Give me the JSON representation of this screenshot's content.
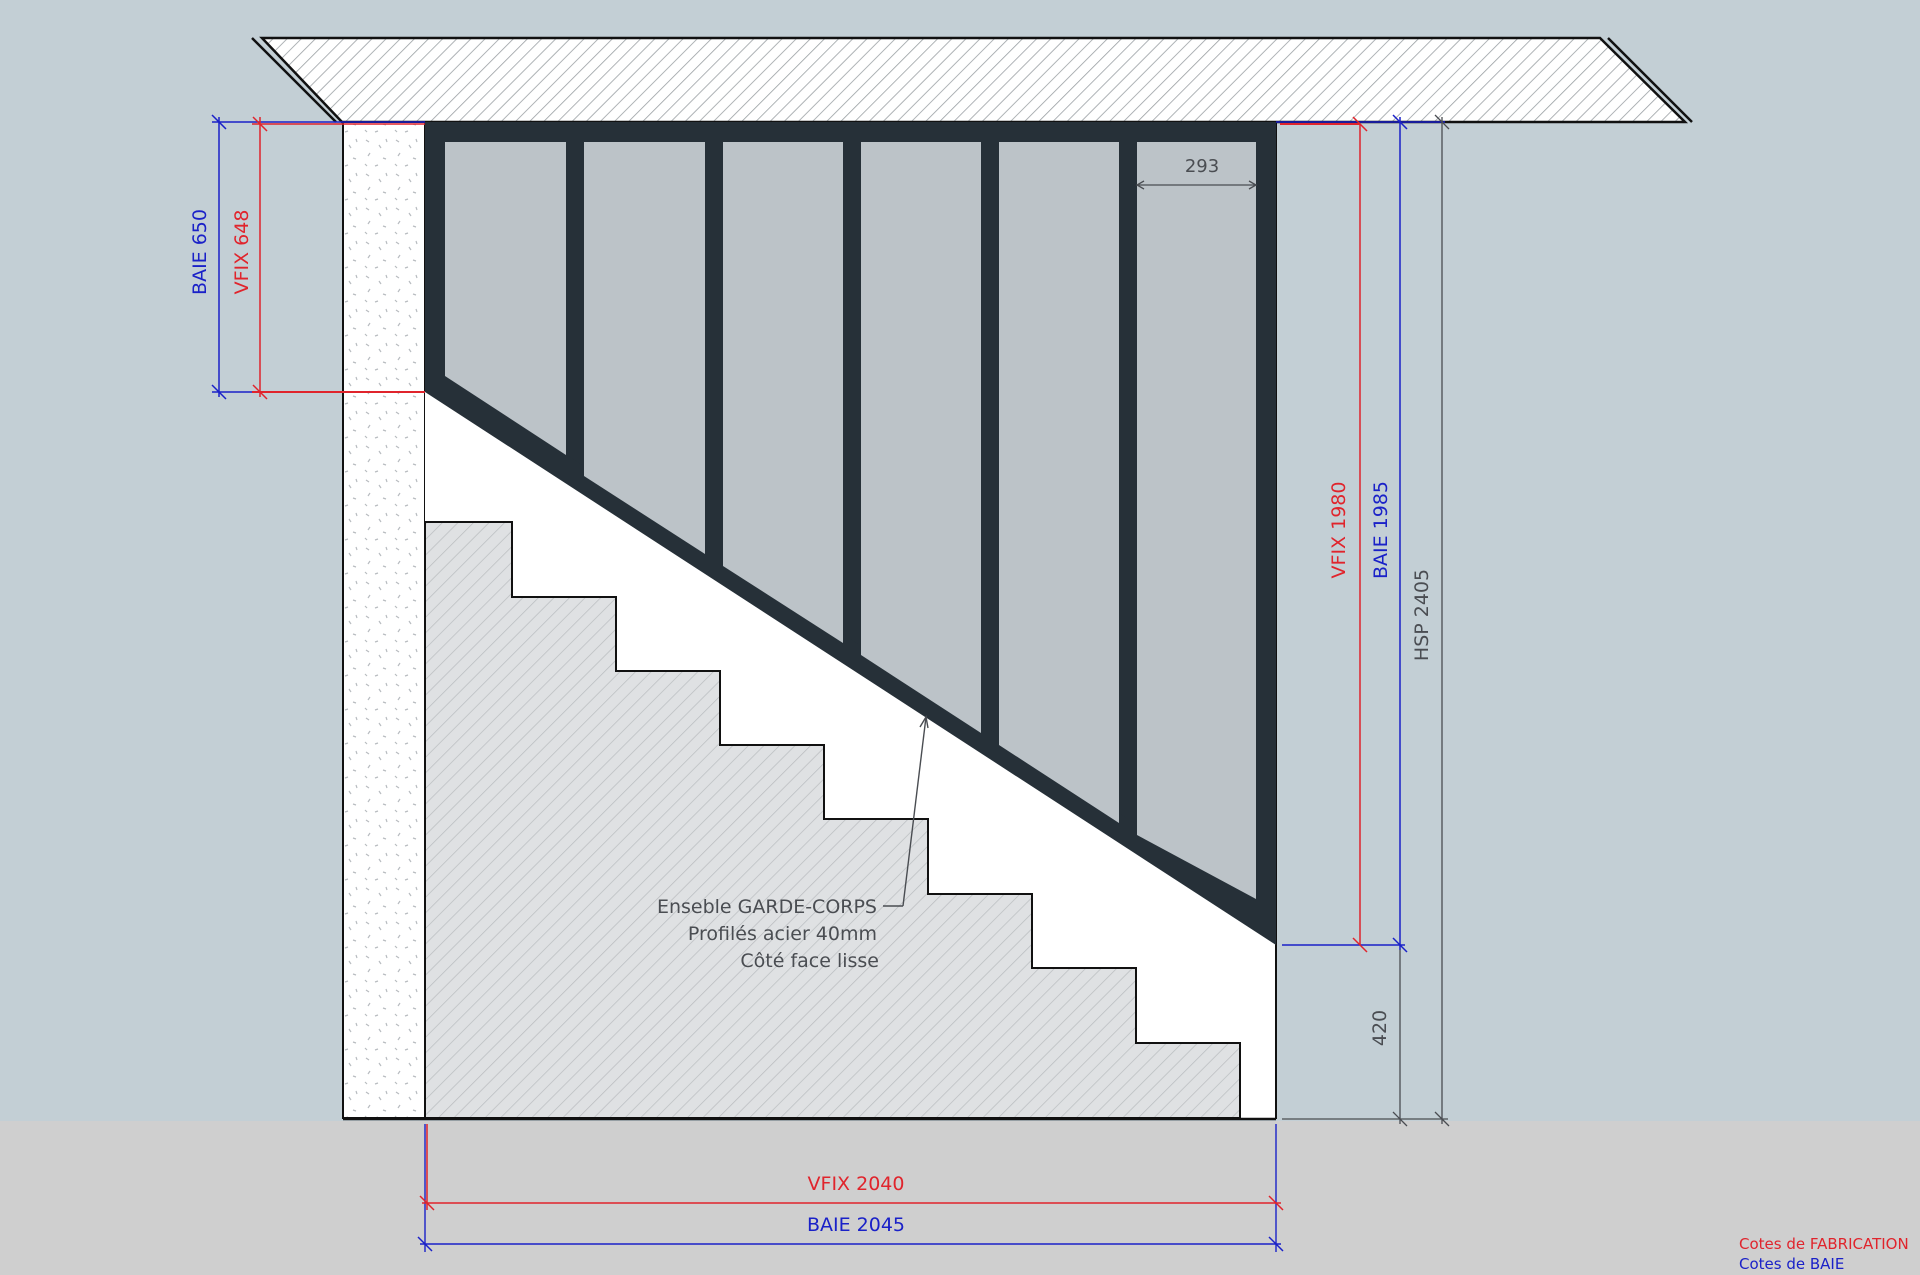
{
  "diagram": {
    "dimensions": {
      "baie_650": "BAIE 650",
      "vfix_648": "VFIX 648",
      "vfix_1980": "VFIX 1980",
      "baie_1985": "BAIE 1985",
      "hsp_2405": "HSP 2405",
      "panel_width": "293",
      "bottom_gap": "420",
      "vfix_2040": "VFIX 2040",
      "baie_2045": "BAIE 2045"
    },
    "annotation": {
      "line1": "Enseble GARDE-CORPS",
      "line2": "Profilés acier 40mm",
      "line3": "Côté face lisse"
    },
    "legend": {
      "fabrication": "Cotes de FABRICATION",
      "baie": "Cotes de BAIE"
    },
    "colors": {
      "background": "#c3cfd5",
      "floor": "#cfcfcf",
      "frame": "#263038",
      "glass": "#bcc3c8",
      "fabrication": "#e0242c",
      "baie": "#1a21c8",
      "neutral": "#4a4d52"
    }
  }
}
